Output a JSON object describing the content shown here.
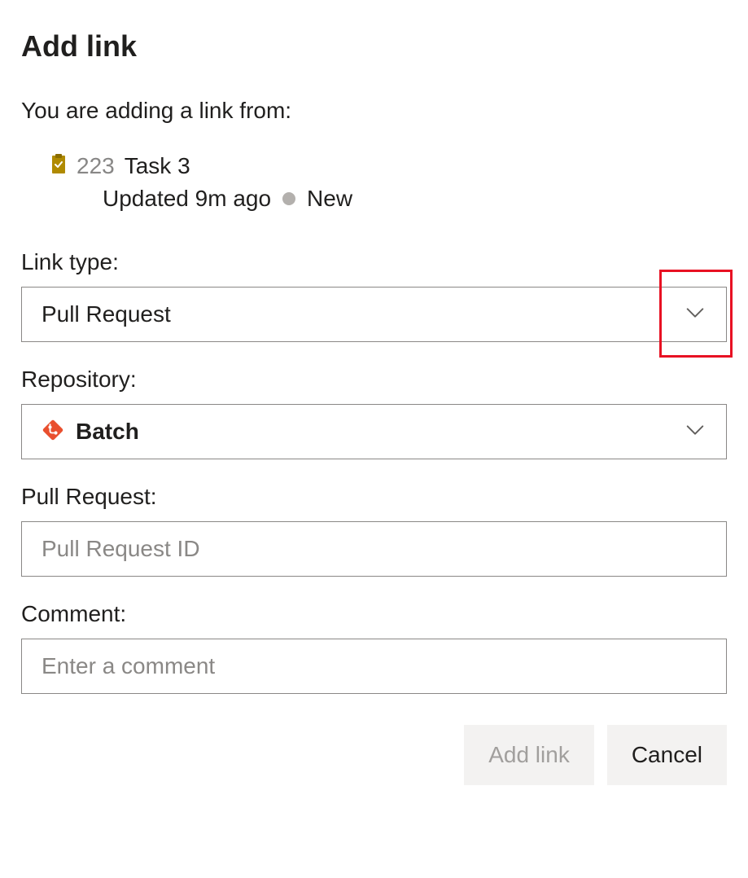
{
  "dialog": {
    "title": "Add link",
    "subtitle": "You are adding a link from:"
  },
  "workItem": {
    "id": "223",
    "title": "Task 3",
    "updatedText": "Updated 9m ago",
    "state": "New"
  },
  "fields": {
    "linkType": {
      "label": "Link type:",
      "value": "Pull Request"
    },
    "repository": {
      "label": "Repository:",
      "value": "Batch"
    },
    "pullRequest": {
      "label": "Pull Request:",
      "placeholder": "Pull Request ID",
      "value": ""
    },
    "comment": {
      "label": "Comment:",
      "placeholder": "Enter a comment",
      "value": ""
    }
  },
  "buttons": {
    "primary": "Add link",
    "secondary": "Cancel"
  }
}
